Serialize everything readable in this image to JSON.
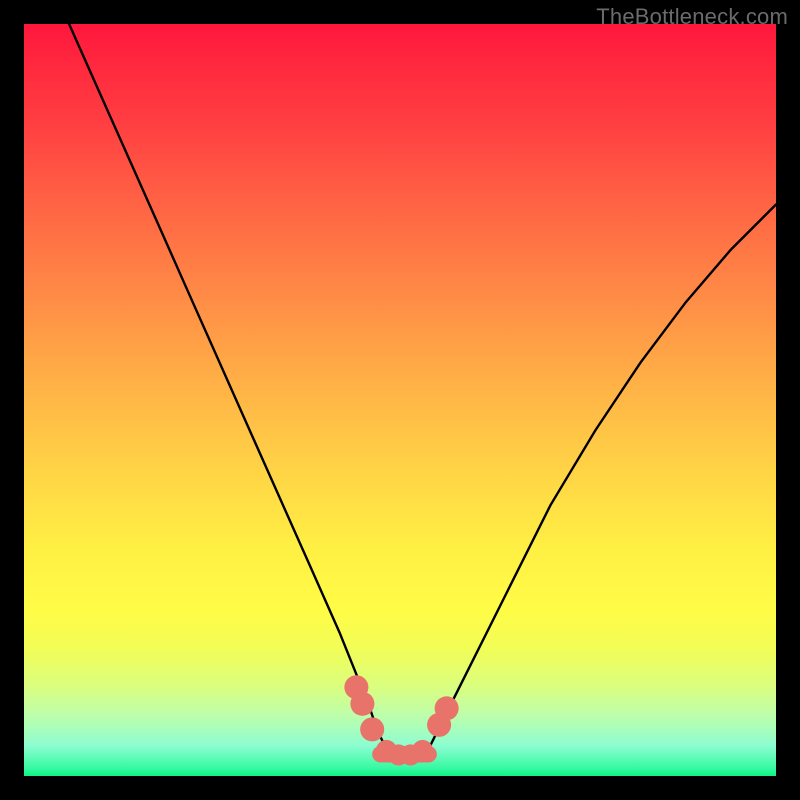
{
  "watermark": {
    "text": "TheBottleneck.com"
  },
  "chart_data": {
    "type": "line",
    "title": "",
    "xlabel": "",
    "ylabel": "",
    "xlim": [
      0,
      100
    ],
    "ylim": [
      0,
      100
    ],
    "series": [
      {
        "name": "bottleneck-curve",
        "color": "#000000",
        "x": [
          6,
          10,
          14,
          18,
          22,
          26,
          30,
          34,
          38,
          42,
          44,
          46,
          47,
          48,
          50,
          52,
          54,
          55,
          57,
          60,
          64,
          70,
          76,
          82,
          88,
          94,
          100
        ],
        "y": [
          100,
          91,
          82,
          73,
          64,
          55,
          46,
          37,
          28,
          19,
          14,
          9,
          6,
          4,
          2.5,
          2.5,
          4,
          6,
          10,
          16,
          24,
          36,
          46,
          55,
          63,
          70,
          76
        ]
      }
    ],
    "markers": [
      {
        "name": "left-threshold-top",
        "x": 44.2,
        "y": 11.8,
        "r": 1.6
      },
      {
        "name": "left-threshold-mid",
        "x": 45.0,
        "y": 9.6,
        "r": 1.6
      },
      {
        "name": "left-threshold-low",
        "x": 46.3,
        "y": 6.2,
        "r": 1.6
      },
      {
        "name": "floor-1",
        "x": 48.2,
        "y": 3.4,
        "r": 1.4
      },
      {
        "name": "floor-2",
        "x": 49.8,
        "y": 2.8,
        "r": 1.4
      },
      {
        "name": "floor-3",
        "x": 51.4,
        "y": 2.8,
        "r": 1.4
      },
      {
        "name": "floor-4",
        "x": 53.0,
        "y": 3.4,
        "r": 1.4
      },
      {
        "name": "right-threshold-low",
        "x": 55.2,
        "y": 6.8,
        "r": 1.6
      },
      {
        "name": "right-threshold-top",
        "x": 56.2,
        "y": 9.0,
        "r": 1.6
      }
    ],
    "floor_band": {
      "x0": 47.4,
      "x1": 53.8,
      "y": 2.9,
      "thickness": 2.2
    },
    "marker_color": "#e8736a",
    "background": {
      "type": "vertical-gradient",
      "stops": [
        [
          "#ff173d",
          0
        ],
        [
          "#ff4142",
          14
        ],
        [
          "#ff7745",
          30
        ],
        [
          "#ffab46",
          46
        ],
        [
          "#ffdb45",
          62
        ],
        [
          "#fffc46",
          78
        ],
        [
          "#dbfe7e",
          88
        ],
        [
          "#8cfdd1",
          96
        ],
        [
          "#0df583",
          100
        ]
      ]
    }
  }
}
